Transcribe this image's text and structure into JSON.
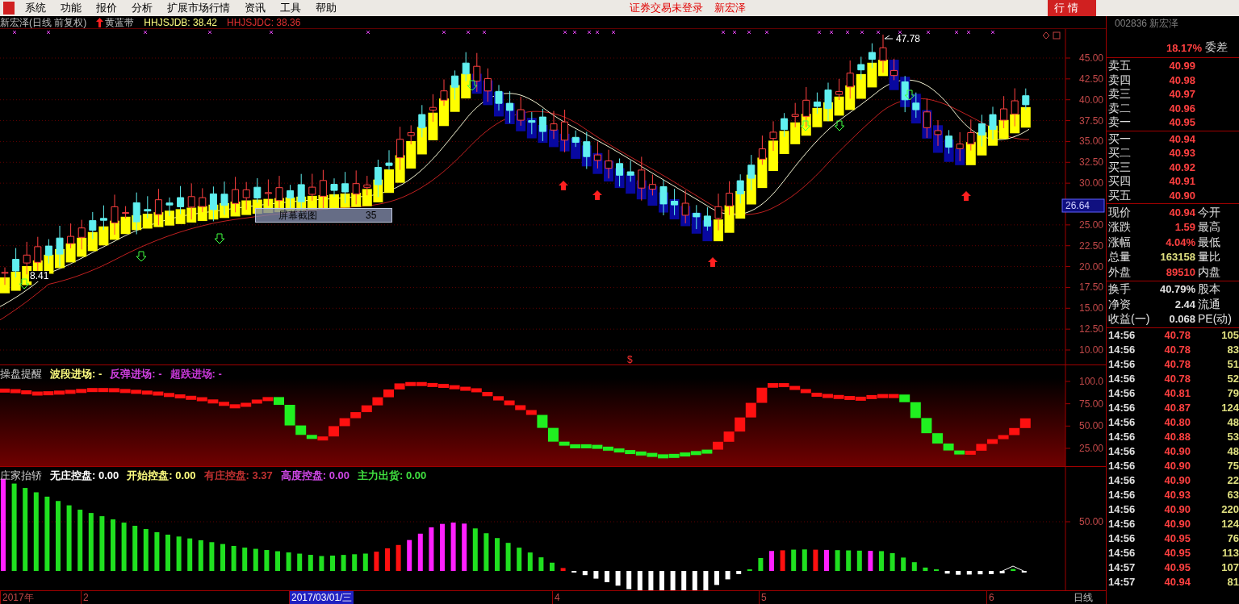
{
  "menu": {
    "items": [
      "系统",
      "功能",
      "报价",
      "分析",
      "扩展市场行情",
      "资讯",
      "工具",
      "帮助"
    ],
    "status": [
      "证券交易未登录",
      "新宏泽"
    ],
    "tab": "行 情"
  },
  "chart": {
    "title": "新宏泽(日线 前复权)",
    "indicator": "黄蓝带",
    "values": [
      {
        "text": "HHJSJDB: 38.42",
        "color": "#ffff80"
      },
      {
        "text": "HHJSJDC: 38.36",
        "color": "#e03030"
      }
    ],
    "high_label": "47.78",
    "low_label": "8.41",
    "signal_mark": "$",
    "tooltip": {
      "text": "屏幕截图",
      "value": "35"
    },
    "yticks": [
      "45.00",
      "42.50",
      "40.00",
      "37.50",
      "35.00",
      "32.50",
      "30.00",
      "25.00",
      "22.50",
      "20.00",
      "17.50",
      "15.00",
      "12.50",
      "10.00"
    ],
    "cursor_price": "26.64"
  },
  "indicator_1": {
    "name": "操盘提醒",
    "items": [
      {
        "text": "波段进场: -",
        "color": "#ffff80"
      },
      {
        "text": "反弹进场: -",
        "color": "#d040e0"
      },
      {
        "text": "超跌进场: -",
        "color": "#c838d8"
      }
    ],
    "yticks": [
      "100.0",
      "75.00",
      "50.00",
      "25.00"
    ]
  },
  "indicator_2": {
    "name": "庄家抬轿",
    "items": [
      {
        "text": "无庄控盘: 0.00",
        "color": "#ffffff"
      },
      {
        "text": "开始控盘: 0.00",
        "color": "#ffff80"
      },
      {
        "text": "有庄控盘: 3.37",
        "color": "#c03030"
      },
      {
        "text": "高度控盘: 0.00",
        "color": "#d048e8"
      },
      {
        "text": "主力出货: 0.00",
        "color": "#40e040"
      }
    ],
    "yticks": [
      "50.00"
    ]
  },
  "date_axis": [
    {
      "text": "2017年",
      "selected": false
    },
    {
      "text": "2",
      "selected": false
    },
    {
      "text": "2017/03/01/三",
      "selected": true
    },
    {
      "text": "4",
      "selected": false
    },
    {
      "text": "5",
      "selected": false
    },
    {
      "text": "6",
      "selected": false
    }
  ],
  "period": "日线",
  "quote": {
    "header": "002836 新宏泽",
    "ratio": "18.17%",
    "ratio_label": "委差",
    "asks": [
      {
        "label": "卖五",
        "price": "40.99"
      },
      {
        "label": "卖四",
        "price": "40.98"
      },
      {
        "label": "卖三",
        "price": "40.97"
      },
      {
        "label": "卖二",
        "price": "40.96"
      },
      {
        "label": "卖一",
        "price": "40.95"
      }
    ],
    "bids": [
      {
        "label": "买一",
        "price": "40.94"
      },
      {
        "label": "买二",
        "price": "40.93"
      },
      {
        "label": "买三",
        "price": "40.92"
      },
      {
        "label": "买四",
        "price": "40.91"
      },
      {
        "label": "买五",
        "price": "40.90"
      }
    ],
    "stats": [
      {
        "label": "现价",
        "value": "40.94",
        "kind": "up",
        "label2": "今开"
      },
      {
        "label": "涨跌",
        "value": "1.59",
        "kind": "up",
        "label2": "最高"
      },
      {
        "label": "涨幅",
        "value": "4.04%",
        "kind": "up",
        "label2": "最低"
      },
      {
        "label": "总量",
        "value": "163158",
        "kind": "volume",
        "label2": "量比"
      },
      {
        "label": "外盘",
        "value": "89510",
        "kind": "up",
        "label2": "内盘"
      }
    ],
    "stats2": [
      {
        "label": "换手",
        "value": "40.79%",
        "kind": "plain",
        "label2": "股本"
      },
      {
        "label": "净资",
        "value": "2.44",
        "kind": "plain",
        "label2": "流通"
      },
      {
        "label": "收益(一)",
        "value": "0.068",
        "kind": "plain",
        "label2": "PE(动)"
      }
    ],
    "ticks": [
      {
        "time": "14:56",
        "price": "40.78",
        "volume": "105"
      },
      {
        "time": "14:56",
        "price": "40.78",
        "volume": "83"
      },
      {
        "time": "14:56",
        "price": "40.78",
        "volume": "51"
      },
      {
        "time": "14:56",
        "price": "40.78",
        "volume": "52"
      },
      {
        "time": "14:56",
        "price": "40.81",
        "volume": "79"
      },
      {
        "time": "14:56",
        "price": "40.87",
        "volume": "124"
      },
      {
        "time": "14:56",
        "price": "40.80",
        "volume": "48"
      },
      {
        "time": "14:56",
        "price": "40.88",
        "volume": "53"
      },
      {
        "time": "14:56",
        "price": "40.90",
        "volume": "48"
      },
      {
        "time": "14:56",
        "price": "40.90",
        "volume": "75"
      },
      {
        "time": "14:56",
        "price": "40.90",
        "volume": "22"
      },
      {
        "time": "14:56",
        "price": "40.93",
        "volume": "63"
      },
      {
        "time": "14:56",
        "price": "40.90",
        "volume": "220"
      },
      {
        "time": "14:56",
        "price": "40.90",
        "volume": "124"
      },
      {
        "time": "14:56",
        "price": "40.95",
        "volume": "76"
      },
      {
        "time": "14:56",
        "price": "40.95",
        "volume": "113"
      },
      {
        "time": "14:57",
        "price": "40.95",
        "volume": "107"
      },
      {
        "time": "14:57",
        "price": "40.94",
        "volume": "81"
      }
    ]
  }
}
